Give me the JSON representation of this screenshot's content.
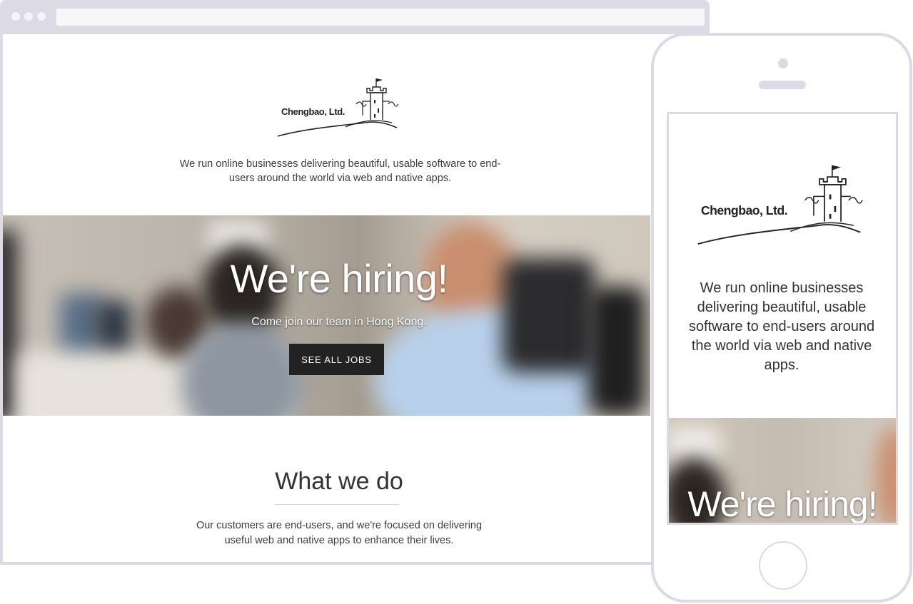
{
  "brand": {
    "name": "Chengbao, Ltd."
  },
  "intro": {
    "tagline": "We run online businesses delivering beautiful, usable software to end-users around the world via web and native apps."
  },
  "hero": {
    "headline": "We're hiring!",
    "subheadline": "Come join our team in Hong Kong.",
    "cta_label": "SEE ALL JOBS"
  },
  "what_we_do": {
    "title": "What we do",
    "text": "Our customers are end-users, and we're focused on delivering useful web and native apps to enhance their lives."
  },
  "colors": {
    "mockup_frame": "#dcdae5",
    "button": "#222222",
    "text": "#333333"
  },
  "icons": [
    "castle-logo-icon"
  ]
}
